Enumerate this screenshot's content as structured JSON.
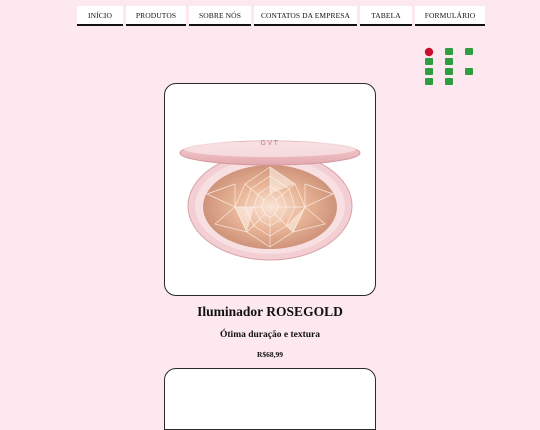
{
  "nav": {
    "items": [
      {
        "label": "INÍCIO"
      },
      {
        "label": "PRODUTOS"
      },
      {
        "label": "SOBRE NÓS"
      },
      {
        "label": "CONTATOS DA EMPRESA"
      },
      {
        "label": "TABELA"
      },
      {
        "label": "FORMULÁRIO"
      }
    ]
  },
  "logo": {
    "icon": "institution-logo-icon",
    "colors": {
      "red": "#c8102e",
      "green": "#2f9e41"
    }
  },
  "product": {
    "brand": "GVT",
    "title": "Iluminador ROSEGOLD",
    "subtitle": "Ótima duração e textura",
    "price": "R$68,99"
  },
  "colors": {
    "background": "#fde8ef",
    "card": "#ffffff"
  }
}
